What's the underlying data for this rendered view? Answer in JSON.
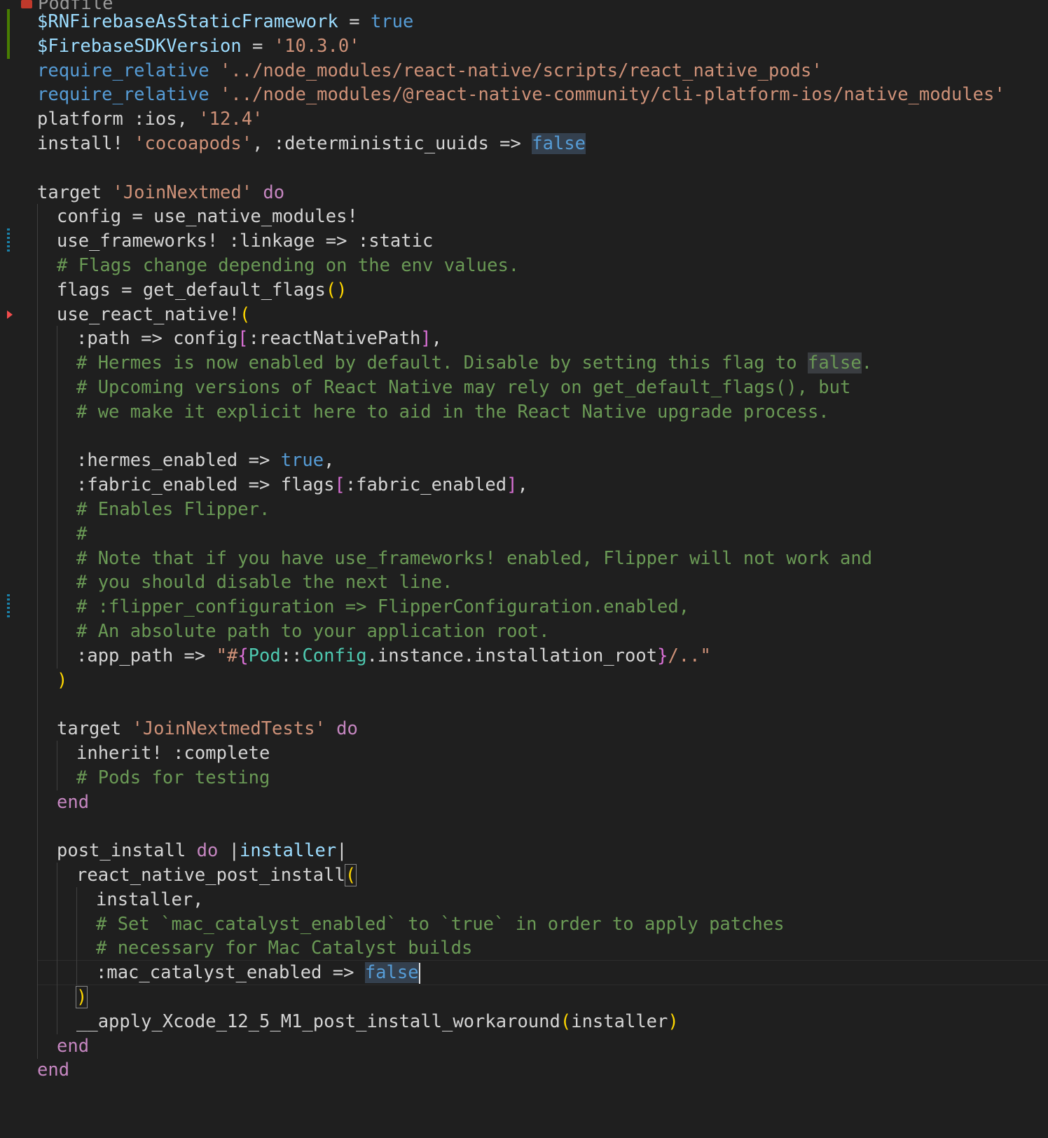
{
  "editor": {
    "file_tab_partial": "Podfile",
    "language": "ruby",
    "lines": [
      {
        "indent": 0,
        "gutter": "added",
        "tokens": [
          {
            "c": "var",
            "t": "$RNFirebaseAsStaticFramework"
          },
          {
            "c": "plain",
            "t": " = "
          },
          {
            "c": "const",
            "t": "true"
          }
        ]
      },
      {
        "indent": 0,
        "gutter": "added",
        "tokens": [
          {
            "c": "var",
            "t": "$FirebaseSDKVersion"
          },
          {
            "c": "plain",
            "t": " = "
          },
          {
            "c": "str",
            "t": "'10.3.0'"
          }
        ]
      },
      {
        "indent": 0,
        "tokens": [
          {
            "c": "const",
            "t": "require_relative"
          },
          {
            "c": "plain",
            "t": " "
          },
          {
            "c": "str",
            "t": "'../node_modules/react-native/scripts/react_native_pods'"
          }
        ]
      },
      {
        "indent": 0,
        "tokens": [
          {
            "c": "const",
            "t": "require_relative"
          },
          {
            "c": "plain",
            "t": " "
          },
          {
            "c": "str",
            "t": "'../node_modules/@react-native-community/cli-platform-ios/native_modules'"
          }
        ]
      },
      {
        "indent": 0,
        "tokens": [
          {
            "c": "plain",
            "t": "platform :ios, "
          },
          {
            "c": "str",
            "t": "'12.4'"
          }
        ]
      },
      {
        "indent": 0,
        "tokens": [
          {
            "c": "plain",
            "t": "install! "
          },
          {
            "c": "str",
            "t": "'cocoapods'"
          },
          {
            "c": "plain",
            "t": ", :deterministic_uuids => "
          },
          {
            "c": "const hl2",
            "t": "false"
          }
        ]
      },
      {
        "indent": 0,
        "tokens": []
      },
      {
        "indent": 0,
        "tokens": [
          {
            "c": "plain",
            "t": "target "
          },
          {
            "c": "str",
            "t": "'JoinNextmed'"
          },
          {
            "c": "plain",
            "t": " "
          },
          {
            "c": "kw",
            "t": "do"
          }
        ]
      },
      {
        "indent": 1,
        "tokens": [
          {
            "c": "plain",
            "t": "config = use_native_modules!"
          }
        ]
      },
      {
        "indent": 1,
        "gutter": "modified",
        "tokens": [
          {
            "c": "plain",
            "t": "use_frameworks! :linkage => :static"
          }
        ]
      },
      {
        "indent": 1,
        "tokens": [
          {
            "c": "com",
            "t": "# Flags change depending on the env values."
          }
        ]
      },
      {
        "indent": 1,
        "tokens": [
          {
            "c": "plain",
            "t": "flags = get_default_flags"
          },
          {
            "c": "br1",
            "t": "()"
          }
        ]
      },
      {
        "indent": 1,
        "gutter": "deleted",
        "tokens": [
          {
            "c": "plain",
            "t": "use_react_native!"
          },
          {
            "c": "br1",
            "t": "("
          }
        ]
      },
      {
        "indent": 2,
        "tokens": [
          {
            "c": "plain",
            "t": ":path => config"
          },
          {
            "c": "br2",
            "t": "["
          },
          {
            "c": "plain",
            "t": ":reactNativePath"
          },
          {
            "c": "br2",
            "t": "]"
          },
          {
            "c": "plain",
            "t": ","
          }
        ]
      },
      {
        "indent": 2,
        "tokens": [
          {
            "c": "com",
            "t": "# Hermes is now enabled by default. Disable by setting this flag to "
          },
          {
            "c": "com hl",
            "t": "false"
          },
          {
            "c": "com",
            "t": "."
          }
        ]
      },
      {
        "indent": 2,
        "tokens": [
          {
            "c": "com",
            "t": "# Upcoming versions of React Native may rely on get_default_flags(), but"
          }
        ]
      },
      {
        "indent": 2,
        "tokens": [
          {
            "c": "com",
            "t": "# we make it explicit here to aid in the React Native upgrade process."
          }
        ]
      },
      {
        "indent": 2,
        "tokens": []
      },
      {
        "indent": 2,
        "tokens": [
          {
            "c": "plain",
            "t": ":hermes_enabled => "
          },
          {
            "c": "const",
            "t": "true"
          },
          {
            "c": "plain",
            "t": ","
          }
        ]
      },
      {
        "indent": 2,
        "tokens": [
          {
            "c": "plain",
            "t": ":fabric_enabled => flags"
          },
          {
            "c": "br2",
            "t": "["
          },
          {
            "c": "plain",
            "t": ":fabric_enabled"
          },
          {
            "c": "br2",
            "t": "]"
          },
          {
            "c": "plain",
            "t": ","
          }
        ]
      },
      {
        "indent": 2,
        "tokens": [
          {
            "c": "com",
            "t": "# Enables Flipper."
          }
        ]
      },
      {
        "indent": 2,
        "tokens": [
          {
            "c": "com",
            "t": "#"
          }
        ]
      },
      {
        "indent": 2,
        "tokens": [
          {
            "c": "com",
            "t": "# Note that if you have use_frameworks! enabled, Flipper will not work and"
          }
        ]
      },
      {
        "indent": 2,
        "tokens": [
          {
            "c": "com",
            "t": "# you should disable the next line."
          }
        ]
      },
      {
        "indent": 2,
        "gutter": "modified",
        "tokens": [
          {
            "c": "com",
            "t": "# :flipper_configuration => FlipperConfiguration.enabled,"
          }
        ]
      },
      {
        "indent": 2,
        "tokens": [
          {
            "c": "com",
            "t": "# An absolute path to your application root."
          }
        ]
      },
      {
        "indent": 2,
        "tokens": [
          {
            "c": "plain",
            "t": ":app_path => "
          },
          {
            "c": "str",
            "t": "\"#"
          },
          {
            "c": "br2",
            "t": "{"
          },
          {
            "c": "type",
            "t": "Pod"
          },
          {
            "c": "plain",
            "t": "::"
          },
          {
            "c": "type",
            "t": "Config"
          },
          {
            "c": "plain",
            "t": ".instance.installation_root"
          },
          {
            "c": "br2",
            "t": "}"
          },
          {
            "c": "str",
            "t": "/..\""
          }
        ]
      },
      {
        "indent": 1,
        "tokens": [
          {
            "c": "br1",
            "t": ")"
          }
        ]
      },
      {
        "indent": 1,
        "tokens": []
      },
      {
        "indent": 1,
        "tokens": [
          {
            "c": "plain",
            "t": "target "
          },
          {
            "c": "str",
            "t": "'JoinNextmedTests'"
          },
          {
            "c": "plain",
            "t": " "
          },
          {
            "c": "kw",
            "t": "do"
          }
        ]
      },
      {
        "indent": 2,
        "tokens": [
          {
            "c": "plain",
            "t": "inherit! :complete"
          }
        ]
      },
      {
        "indent": 2,
        "tokens": [
          {
            "c": "com",
            "t": "# Pods for testing"
          }
        ]
      },
      {
        "indent": 1,
        "tokens": [
          {
            "c": "kw",
            "t": "end"
          }
        ]
      },
      {
        "indent": 1,
        "tokens": []
      },
      {
        "indent": 1,
        "tokens": [
          {
            "c": "plain",
            "t": "post_install "
          },
          {
            "c": "kw",
            "t": "do"
          },
          {
            "c": "plain",
            "t": " |"
          },
          {
            "c": "var",
            "t": "installer"
          },
          {
            "c": "plain",
            "t": "|"
          }
        ]
      },
      {
        "indent": 2,
        "tokens": [
          {
            "c": "plain",
            "t": "react_native_post_install"
          },
          {
            "c": "br1 brmatch",
            "t": "("
          }
        ]
      },
      {
        "indent": 3,
        "tokens": [
          {
            "c": "plain",
            "t": "installer,"
          }
        ]
      },
      {
        "indent": 3,
        "tokens": [
          {
            "c": "com",
            "t": "# Set `mac_catalyst_enabled` to `true` in order to apply patches"
          }
        ]
      },
      {
        "indent": 3,
        "tokens": [
          {
            "c": "com",
            "t": "# necessary for Mac Catalyst builds"
          }
        ]
      },
      {
        "indent": 3,
        "current": true,
        "cursor": true,
        "tokens": [
          {
            "c": "plain",
            "t": ":mac_catalyst_enabled => "
          },
          {
            "c": "const hl2",
            "t": "false"
          }
        ]
      },
      {
        "indent": 2,
        "tokens": [
          {
            "c": "br1 brmatch",
            "t": ")"
          }
        ]
      },
      {
        "indent": 2,
        "tokens": [
          {
            "c": "plain",
            "t": "__apply_Xcode_12_5_M1_post_install_workaround"
          },
          {
            "c": "br1",
            "t": "("
          },
          {
            "c": "plain",
            "t": "installer"
          },
          {
            "c": "br1",
            "t": ")"
          }
        ]
      },
      {
        "indent": 1,
        "tokens": [
          {
            "c": "kw",
            "t": "end"
          }
        ]
      },
      {
        "indent": 0,
        "tokens": [
          {
            "c": "kw",
            "t": "end"
          }
        ]
      }
    ]
  }
}
